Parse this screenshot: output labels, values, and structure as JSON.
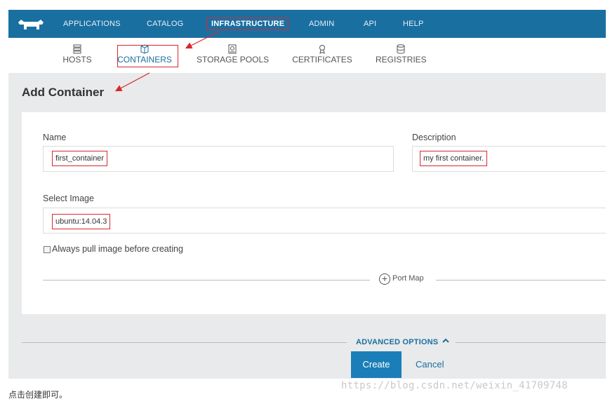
{
  "top_nav": {
    "items": [
      {
        "label": "APPLICATIONS"
      },
      {
        "label": "CATALOG"
      },
      {
        "label": "INFRASTRUCTURE"
      },
      {
        "label": "ADMIN"
      },
      {
        "label": "API"
      },
      {
        "label": "HELP"
      }
    ],
    "active": "INFRASTRUCTURE"
  },
  "sub_nav": {
    "items": [
      {
        "label": "HOSTS",
        "icon": "server-icon"
      },
      {
        "label": "CONTAINERS",
        "icon": "cube-icon"
      },
      {
        "label": "STORAGE POOLS",
        "icon": "storage-icon"
      },
      {
        "label": "CERTIFICATES",
        "icon": "certificate-icon"
      },
      {
        "label": "REGISTRIES",
        "icon": "database-icon"
      }
    ],
    "active": "CONTAINERS"
  },
  "page": {
    "title": "Add Container"
  },
  "form": {
    "name_label": "Name",
    "name_value": "first_container",
    "description_label": "Description",
    "description_value": "my first container.",
    "image_label": "Select Image",
    "image_value": "ubuntu:14.04.3",
    "always_pull_label": "Always pull image before creating",
    "always_pull_checked": false,
    "port_map_label": "Port Map",
    "advanced_options_label": "ADVANCED OPTIONS",
    "create_label": "Create",
    "cancel_label": "Cancel"
  },
  "caption": "点击创建即可。",
  "watermark": "https://blog.csdn.net/weixin_41709748",
  "colors": {
    "nav_bg": "#1a6fa1",
    "content_bg": "#e9eaeb",
    "accent": "#1a7fb8",
    "annotation": "#d9272e"
  }
}
